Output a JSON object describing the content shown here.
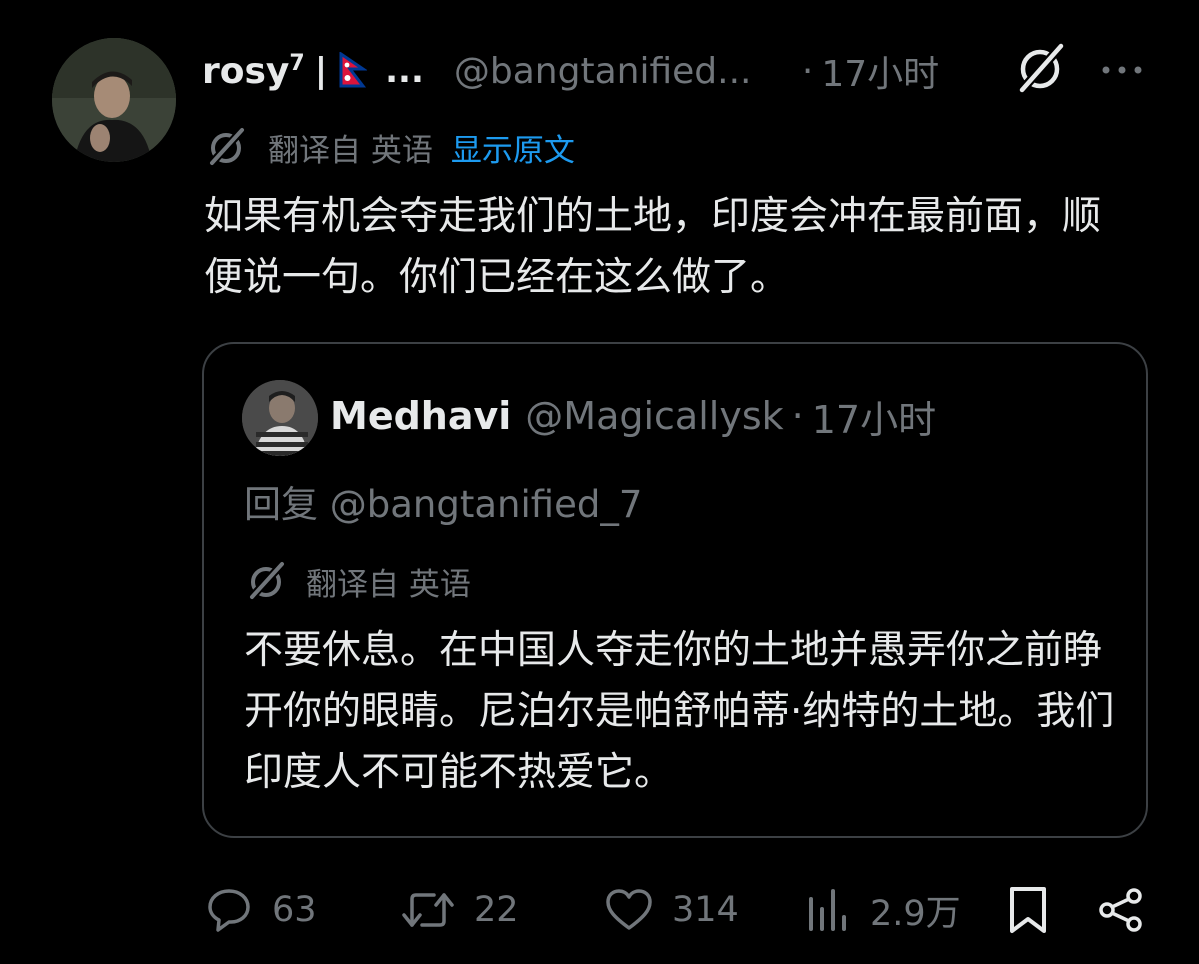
{
  "post": {
    "author_name": "rosy",
    "author_sup": "7",
    "name_separator": "|",
    "name_truncation": "...",
    "handle": "@bangtanified...",
    "dot": "·",
    "time": "17小时",
    "translated_from": "翻译自 英语",
    "show_original": "显示原文",
    "text": "如果有机会夺走我们的土地，印度会冲在最前面，顺便说一句。你们已经在这么做了。"
  },
  "quote": {
    "author_name": "Medhavi",
    "handle": "@Magicallysk",
    "dot": "·",
    "time": "17小时",
    "reply_to": "回复 @bangtanified_7",
    "translated_from": "翻译自 英语",
    "text": "不要休息。在中国人夺走你的土地并愚弄你之前睁开你的眼睛。尼泊尔是帕舒帕蒂·纳特的土地。我们印度人不可能不热爱它。"
  },
  "actions": {
    "replies": "63",
    "reposts": "22",
    "likes": "314",
    "views": "2.9万"
  },
  "icons": {
    "grok": "grok-slash-icon",
    "more": "more-dots-icon",
    "translate": "translate-slash-icon",
    "reply": "reply-bubble-icon",
    "repost": "repost-arrows-icon",
    "like": "heart-icon",
    "views": "analytics-bars-icon",
    "bookmark": "bookmark-icon",
    "share": "share-icon"
  },
  "colors": {
    "background": "#000000",
    "text": "#e7e9ea",
    "secondary": "#71767b",
    "link": "#1d9bf0",
    "border": "#3c4044"
  }
}
